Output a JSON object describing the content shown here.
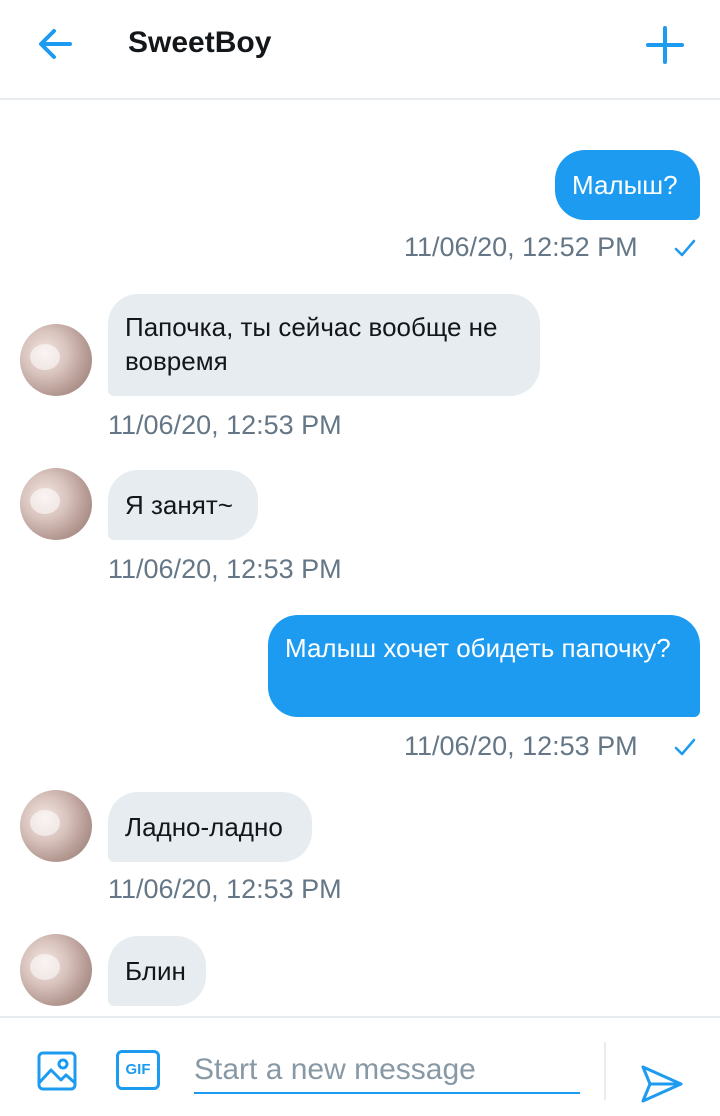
{
  "header": {
    "title": "SweetBoy",
    "back_icon": "arrow-left-icon",
    "add_icon": "plus-icon"
  },
  "thread": {
    "messages": [
      {
        "direction": "outgoing",
        "text": "Малыш?",
        "timestamp": "11/06/20, 12:52 PM",
        "status": "sent-check"
      },
      {
        "direction": "incoming",
        "text": "Папочка, ты сейчас вообще не вовремя",
        "timestamp": "11/06/20, 12:53 PM"
      },
      {
        "direction": "incoming",
        "text": "Я занят~",
        "timestamp": "11/06/20, 12:53 PM"
      },
      {
        "direction": "outgoing",
        "text": "Малыш хочет обидеть папочку?",
        "timestamp": "11/06/20, 12:53 PM",
        "status": "sent-check"
      },
      {
        "direction": "incoming",
        "text": "Ладно-ладно",
        "timestamp": "11/06/20, 12:53 PM"
      },
      {
        "direction": "incoming",
        "text": "Блин"
      }
    ]
  },
  "composer": {
    "placeholder": "Start a new message",
    "gif_label": "GIF",
    "media_icon": "image-icon",
    "send_icon": "send-icon"
  },
  "colors": {
    "accent": "#1d9bf0",
    "incoming_bubble": "#e6ecf0",
    "timestamp": "#657786"
  }
}
